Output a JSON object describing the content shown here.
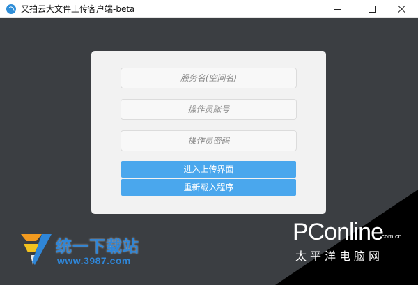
{
  "window": {
    "title": "又拍云大文件上传客户端-beta"
  },
  "login": {
    "service_placeholder": "服务名(空间名)",
    "operator_placeholder": "操作员账号",
    "password_placeholder": "操作员密码",
    "enter_button": "进入上传界面",
    "reload_button": "重新载入程序"
  },
  "watermarks": {
    "left_title": "统一下载站",
    "left_url": "www.3987.com",
    "right_brand": "PConline",
    "right_domain": ".com.cn",
    "right_cn": "太平洋电脑网"
  },
  "colors": {
    "background": "#3b3e42",
    "panel": "#f2f2f2",
    "button": "#4aa7ed",
    "app_icon": "#2f8ed8"
  }
}
